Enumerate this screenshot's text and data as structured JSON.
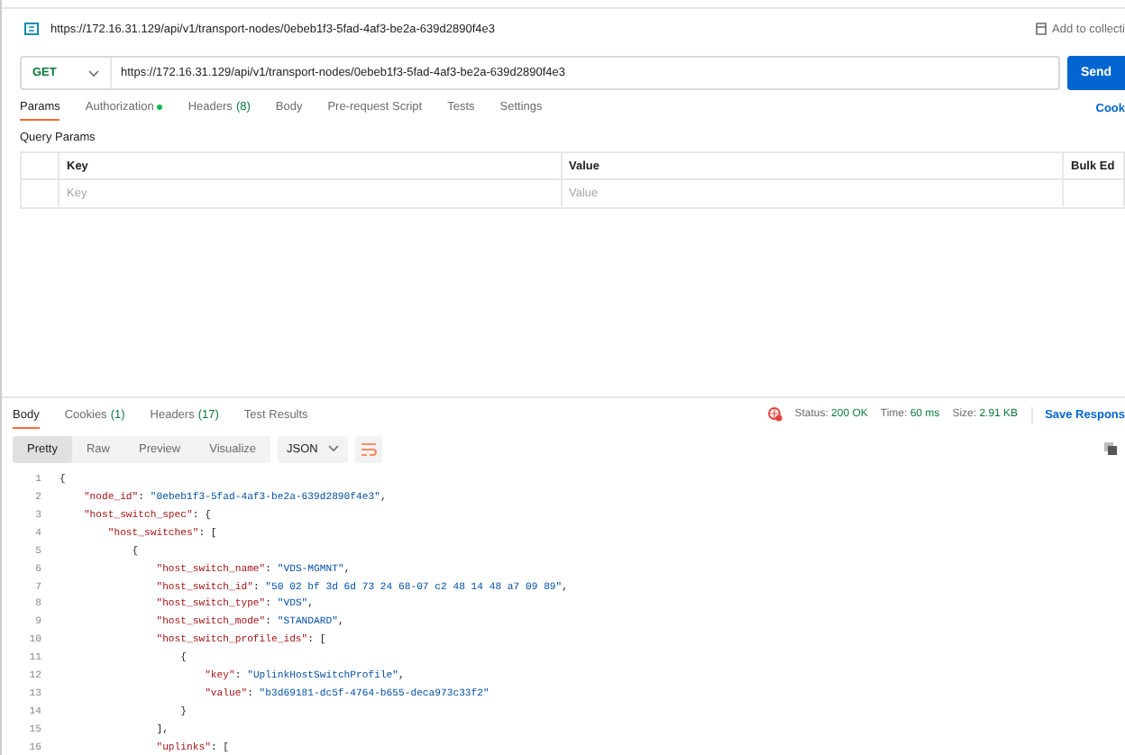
{
  "request_title": {
    "url": "https://172.16.31.129/api/v1/transport-nodes/0ebeb1f3-5fad-4af3-be2a-639d2890f4e3"
  },
  "add_to_collection": "Add to collecti",
  "request_bar": {
    "method": "GET",
    "url": "https://172.16.31.129/api/v1/transport-nodes/0ebeb1f3-5fad-4af3-be2a-639d2890f4e3",
    "send": "Send"
  },
  "request_tabs": [
    {
      "label": "Params",
      "selected": true
    },
    {
      "label": "Authorization",
      "selected": false,
      "indicator": true
    },
    {
      "label": "Headers",
      "count": "(8)",
      "selected": false
    },
    {
      "label": "Body",
      "selected": false
    },
    {
      "label": "Pre-request Script",
      "selected": false
    },
    {
      "label": "Tests",
      "selected": false
    },
    {
      "label": "Settings",
      "selected": false
    }
  ],
  "cookies_link": "Cook",
  "query_params": {
    "title": "Query Params",
    "columns": [
      "Key",
      "Value",
      "Bulk Ed"
    ],
    "key_placeholder": "Key",
    "value_placeholder": "Value"
  },
  "response_tabs": [
    {
      "label": "Body",
      "selected": true
    },
    {
      "label": "Cookies",
      "count": "(1)",
      "selected": false
    },
    {
      "label": "Headers",
      "count": "(17)",
      "selected": false
    },
    {
      "label": "Test Results",
      "selected": false
    }
  ],
  "response_status": [
    {
      "label": "Status:",
      "value": "200 OK"
    },
    {
      "label": "Time:",
      "value": "60 ms"
    },
    {
      "label": "Size:",
      "value": "2.91 KB"
    }
  ],
  "save_response": "Save Respons",
  "view_modes": [
    {
      "label": "Pretty",
      "selected": true
    },
    {
      "label": "Raw",
      "selected": false
    },
    {
      "label": "Preview",
      "selected": false
    },
    {
      "label": "Visualize",
      "selected": false
    }
  ],
  "format": "JSON",
  "code_lines": [
    {
      "number": "1",
      "text": "{"
    },
    {
      "number": "2",
      "text": "    \"node_id\": \"0ebeb1f3-5fad-4af3-be2a-639d2890f4e3\","
    },
    {
      "number": "3",
      "text": "    \"host_switch_spec\": {"
    },
    {
      "number": "4",
      "text": "        \"host_switches\": ["
    },
    {
      "number": "5",
      "text": "            {"
    },
    {
      "number": "6",
      "text": "                \"host_switch_name\": \"VDS-MGMNT\","
    },
    {
      "number": "7",
      "text": "                \"host_switch_id\": \"50 02 bf 3d 6d 73 24 68-07 c2 48 14 48 a7 09 89\","
    },
    {
      "number": "8",
      "text": "                \"host_switch_type\": \"VDS\","
    },
    {
      "number": "9",
      "text": "                \"host_switch_mode\": \"STANDARD\","
    },
    {
      "number": "10",
      "text": "                \"host_switch_profile_ids\": ["
    },
    {
      "number": "11",
      "text": "                    {"
    },
    {
      "number": "12",
      "text": "                        \"key\": \"UplinkHostSwitchProfile\","
    },
    {
      "number": "13",
      "text": "                        \"value\": \"b3d69181-dc5f-4764-b655-deca973c33f2\""
    },
    {
      "number": "14",
      "text": "                    }"
    },
    {
      "number": "15",
      "text": "                ],"
    },
    {
      "number": "16",
      "text": "                \"uplinks\": ["
    }
  ]
}
